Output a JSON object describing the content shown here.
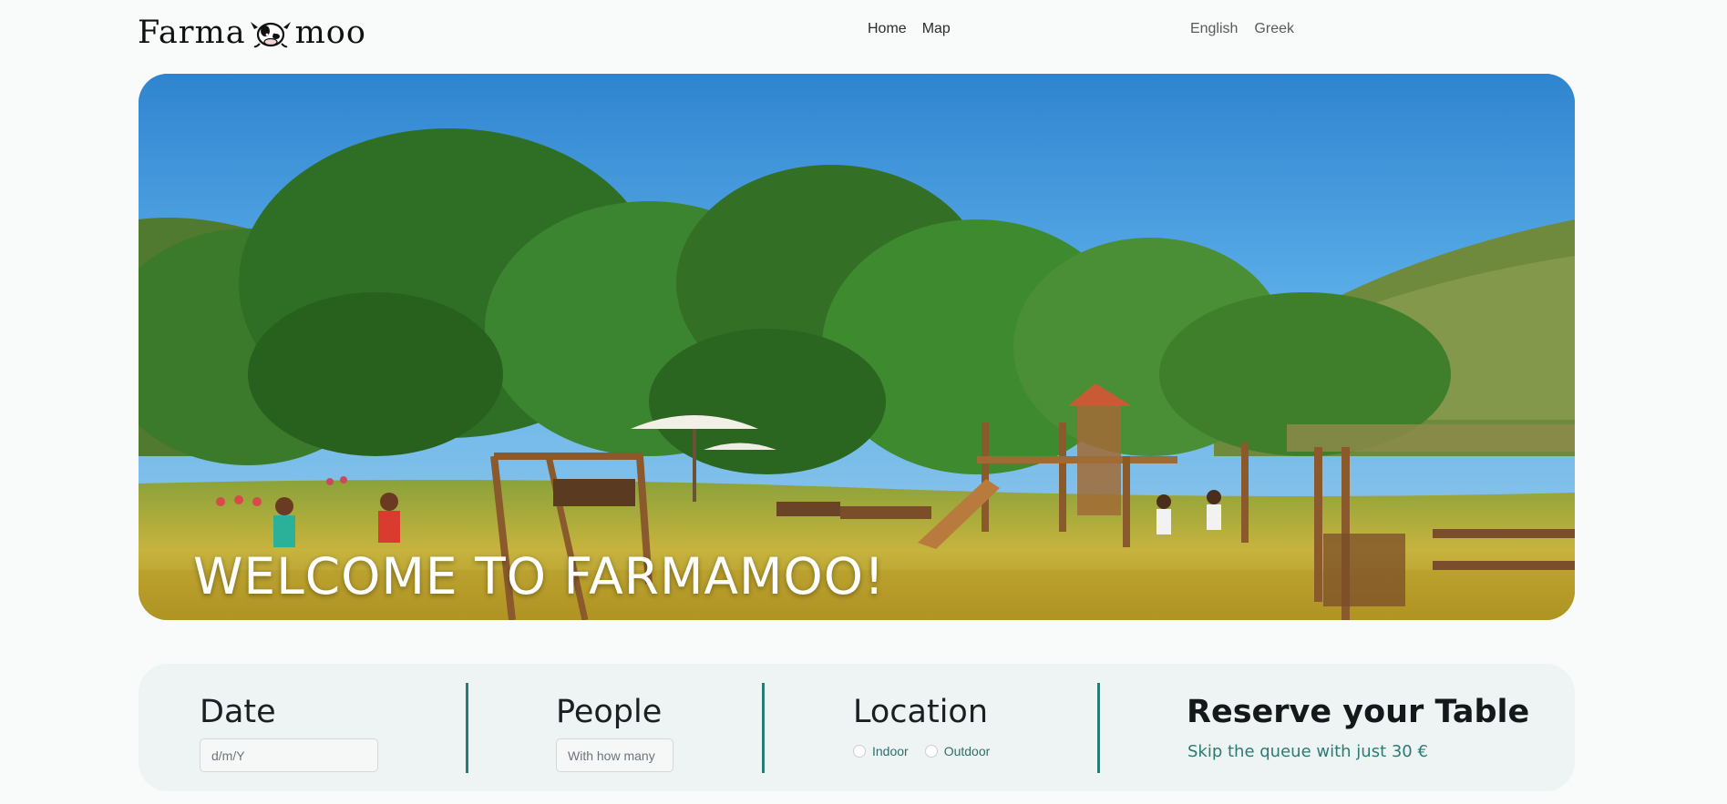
{
  "nav": {
    "logo_left": "Farma",
    "logo_right": "moo",
    "links": [
      "Home",
      "Map"
    ],
    "languages": [
      "English",
      "Greek"
    ]
  },
  "hero": {
    "title": "WELCOME TO FARMAMOO!"
  },
  "booking": {
    "date_heading": "Date",
    "date_placeholder": "d/m/Y",
    "people_heading": "People",
    "people_placeholder": "With how many",
    "location_heading": "Location",
    "location_options": [
      "Indoor",
      "Outdoor"
    ],
    "reserve_title": "Reserve your Table",
    "reserve_subtitle": "Skip the queue with just 30 €"
  },
  "colors": {
    "accent": "#2b7b74",
    "booking_bg": "#eef4f3",
    "page_bg": "#f9fafa"
  }
}
